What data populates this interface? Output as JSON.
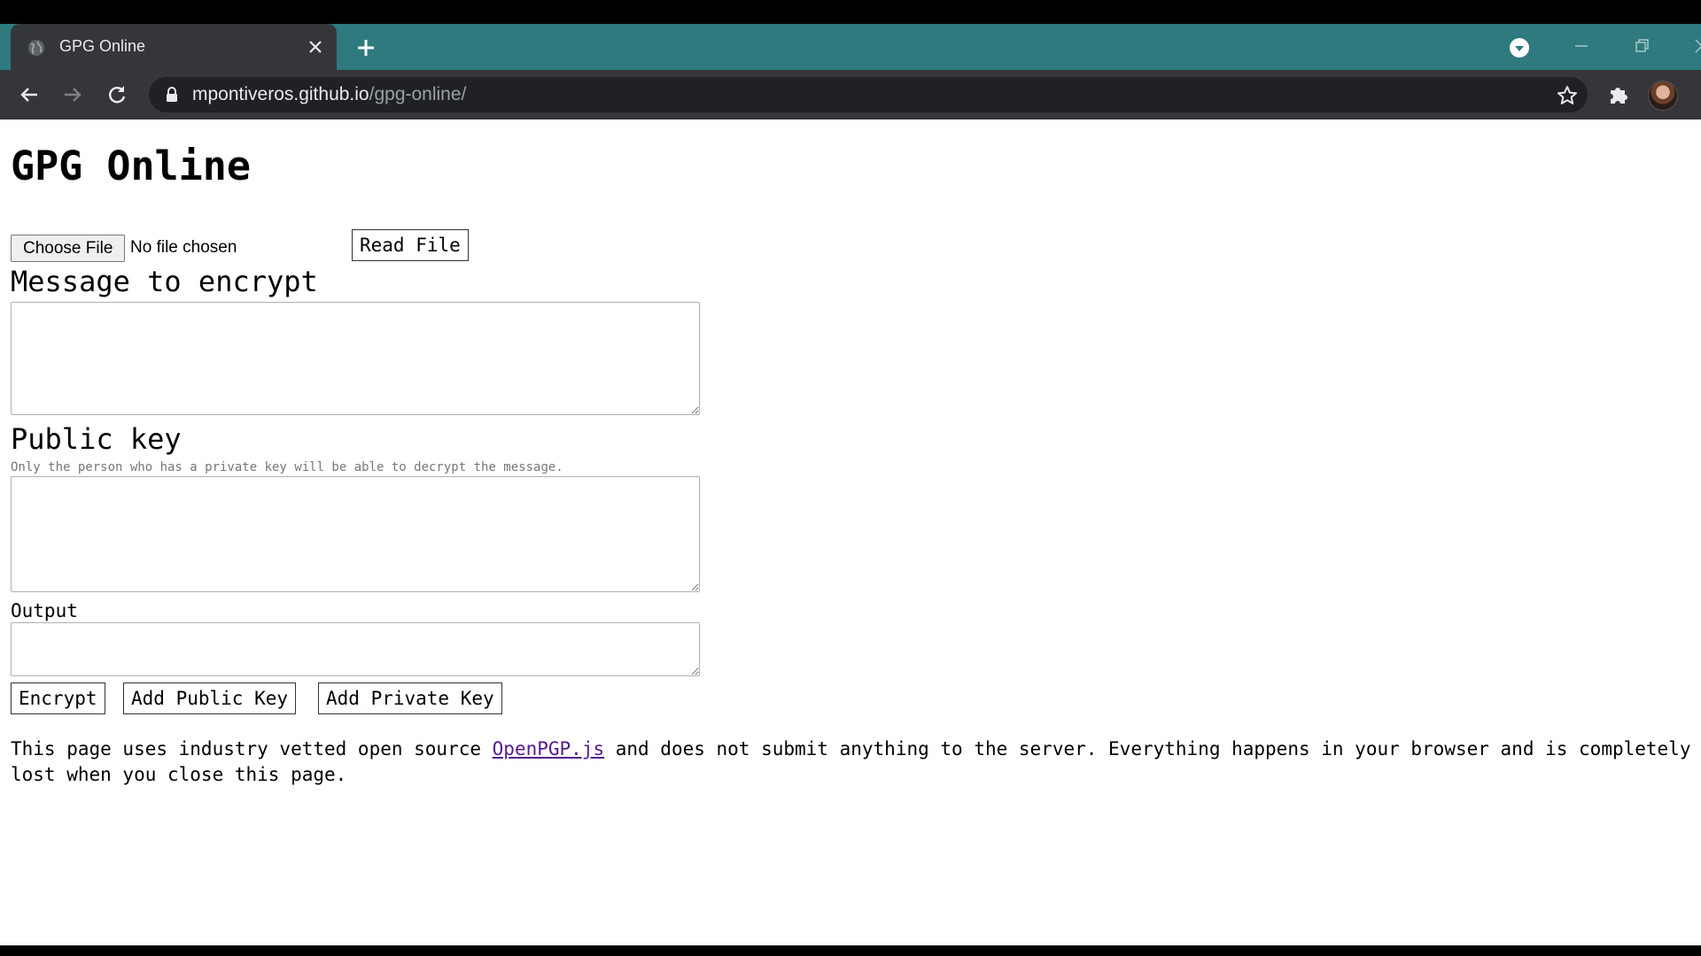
{
  "browser": {
    "tab_title": "GPG Online",
    "url_host": "mpontiveros.github.io",
    "url_path": "/gpg-online/",
    "accent": "#2e7a7e"
  },
  "icons": {
    "favicon": "globe-icon",
    "tab_close": "close-icon",
    "new_tab": "plus-icon",
    "tab_search": "chevron-down-circle-icon",
    "back": "arrow-left-icon",
    "forward": "arrow-right-icon",
    "reload": "reload-icon",
    "lock": "lock-icon",
    "bookmark": "star-icon",
    "extensions": "puzzle-icon"
  },
  "page": {
    "title": "GPG Online",
    "choose_file_label": "Choose File",
    "no_file_text": "No file chosen",
    "read_file_label": "Read File",
    "message_label": "Message to encrypt",
    "message_value": "",
    "public_key_label": "Public key",
    "public_key_hint": "Only the person who has a private key will be able to decrypt the message.",
    "public_key_value": "",
    "output_label": "Output",
    "output_value": "",
    "encrypt_label": "Encrypt",
    "add_public_key_label": "Add Public Key",
    "add_private_key_label": "Add Private Key",
    "footer_before": "This page uses industry vetted open source ",
    "footer_link": "OpenPGP.js",
    "footer_after": " and does not submit anything to the server. Everything happens in your browser and is completely lost when you close this page.",
    "link_color": "#551a8b"
  }
}
